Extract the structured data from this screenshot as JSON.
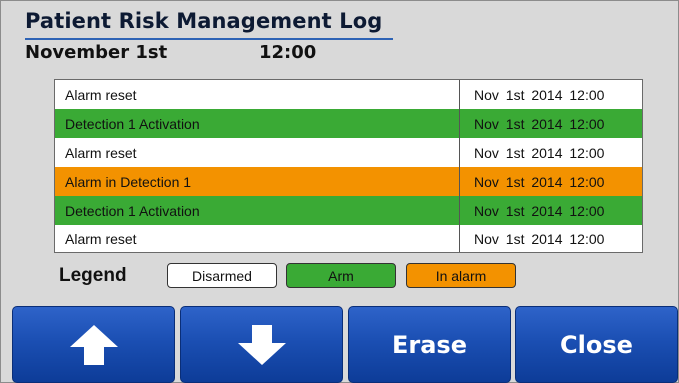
{
  "header": {
    "title": "Patient Risk Management Log",
    "date": "November 1st",
    "time": "12:00"
  },
  "log": {
    "rows": [
      {
        "event": "Alarm reset",
        "timestamp": "Nov 1st 2014 12:00",
        "status": "disarmed"
      },
      {
        "event": "Detection 1 Activation",
        "timestamp": "Nov 1st 2014 12:00",
        "status": "arm"
      },
      {
        "event": "Alarm reset",
        "timestamp": "Nov 1st 2014 12:00",
        "status": "disarmed"
      },
      {
        "event": "Alarm in Detection 1",
        "timestamp": "Nov 1st 2014 12:00",
        "status": "in-alarm"
      },
      {
        "event": "Detection 1 Activation",
        "timestamp": "Nov 1st 2014 12:00",
        "status": "arm"
      },
      {
        "event": "Alarm reset",
        "timestamp": "Nov 1st 2014 12:00",
        "status": "disarmed"
      }
    ]
  },
  "legend": {
    "label": "Legend",
    "disarmed": "Disarmed",
    "arm": "Arm",
    "in_alarm": "In alarm"
  },
  "colors": {
    "disarmed": "#ffffff",
    "arm": "#3aaa35",
    "in_alarm": "#f39200",
    "button": "#1b4fb3"
  },
  "buttons": {
    "up_icon": "arrow-up-icon",
    "down_icon": "arrow-down-icon",
    "erase": "Erase",
    "close": "Close"
  }
}
